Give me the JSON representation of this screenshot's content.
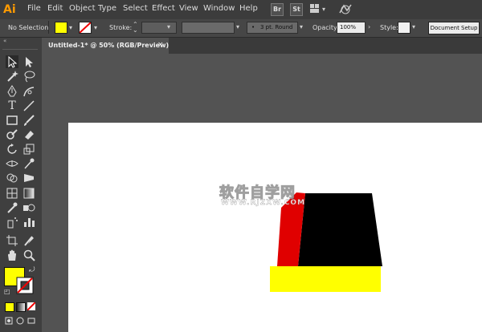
{
  "app": {
    "logo": "Ai"
  },
  "menu": [
    "File",
    "Edit",
    "Object",
    "Type",
    "Select",
    "Effect",
    "View",
    "Window",
    "Help"
  ],
  "menu_buttons": {
    "bridge": "Br",
    "stock": "St"
  },
  "control_bar": {
    "selection_status": "No Selection",
    "fill_color": "#ffff00",
    "stroke_label": "Stroke:",
    "brush_value": "3 pt. Round",
    "opacity_label": "Opacity:",
    "opacity_value": "100%",
    "style_label": "Style:",
    "document_setup": "Document Setup"
  },
  "document_tab": {
    "title": "Untitled-1* @ 50% (RGB/Preview)",
    "close": "×"
  },
  "tools": [
    "selection-tool",
    "direct-selection-tool",
    "magic-wand-tool",
    "lasso-tool",
    "pen-tool",
    "curvature-tool",
    "type-tool",
    "line-tool",
    "rectangle-tool",
    "paintbrush-tool",
    "shaper-tool",
    "eraser-tool",
    "rotate-tool",
    "scale-tool",
    "width-tool",
    "puppet-warp-tool",
    "shape-builder-tool",
    "perspective-tool",
    "mesh-tool",
    "gradient-tool",
    "eyedropper-tool",
    "blend-tool",
    "symbol-sprayer-tool",
    "column-graph-tool",
    "artboard-tool",
    "slice-tool",
    "hand-tool",
    "zoom-tool"
  ],
  "swatches": {
    "fill": "#ffff00",
    "stroke": "none"
  },
  "watermark": {
    "line1": "软件自学网",
    "line2": "WWW.RJZXW.COM"
  },
  "artwork_colors": {
    "black": "#000000",
    "red": "#e00000",
    "yellow": "#ffff00"
  }
}
